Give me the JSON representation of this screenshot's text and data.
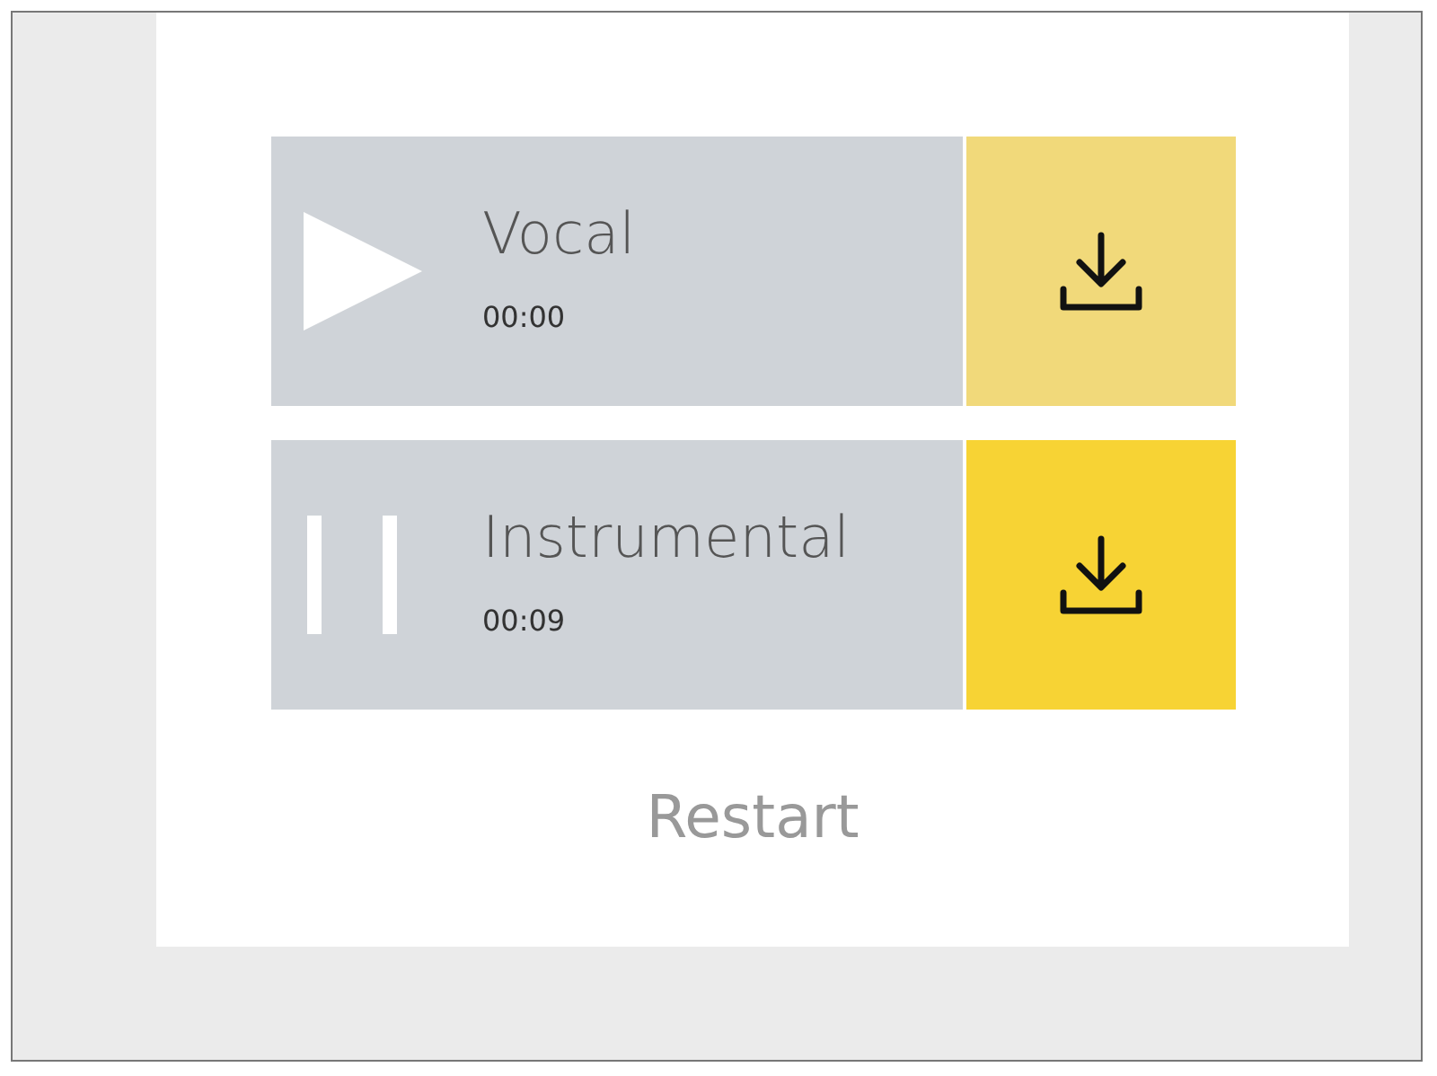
{
  "tracks": [
    {
      "name": "Vocal",
      "time": "00:00",
      "playing": false
    },
    {
      "name": "Instrumental",
      "time": "00:09",
      "playing": true
    }
  ],
  "restart": "Restart"
}
